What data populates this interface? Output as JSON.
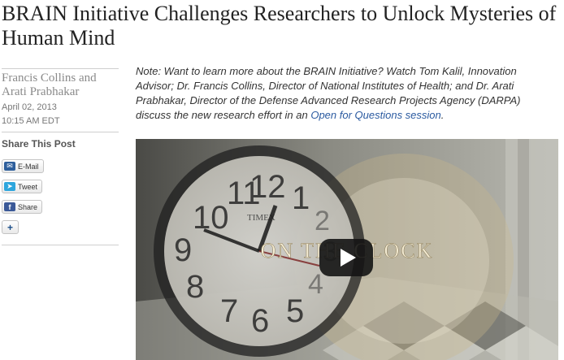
{
  "article": {
    "title": "BRAIN Initiative Challenges Researchers to Unlock Mysteries of Human Mind",
    "author": "Francis Collins and Arati Prabhakar",
    "date": "April 02, 2013",
    "time": "10:15 AM EDT"
  },
  "share": {
    "heading": "Share This Post",
    "email_label": "E-Mail",
    "tweet_label": "Tweet",
    "share_label": "Share",
    "plus_icon": "+"
  },
  "note": {
    "text_before_link": "Note: Want to learn more about the BRAIN Initiative? Watch Tom Kalil, Innovation Advisor; Dr. Francis Collins, Director of National Institutes of Health; and Dr. Arati Prabhakar, Director of the Defense Advanced Research Projects Agency (DARPA) discuss the new research effort in an ",
    "link_text": "Open for Questions session",
    "text_after_link": "."
  },
  "video": {
    "overlay_text": "ON THE CLOCK",
    "clock_brand": "TIMEX",
    "play_icon": "play-icon"
  },
  "colors": {
    "link": "#2a5aa0",
    "muted": "#8a8a8a",
    "play_button": "#141414"
  }
}
